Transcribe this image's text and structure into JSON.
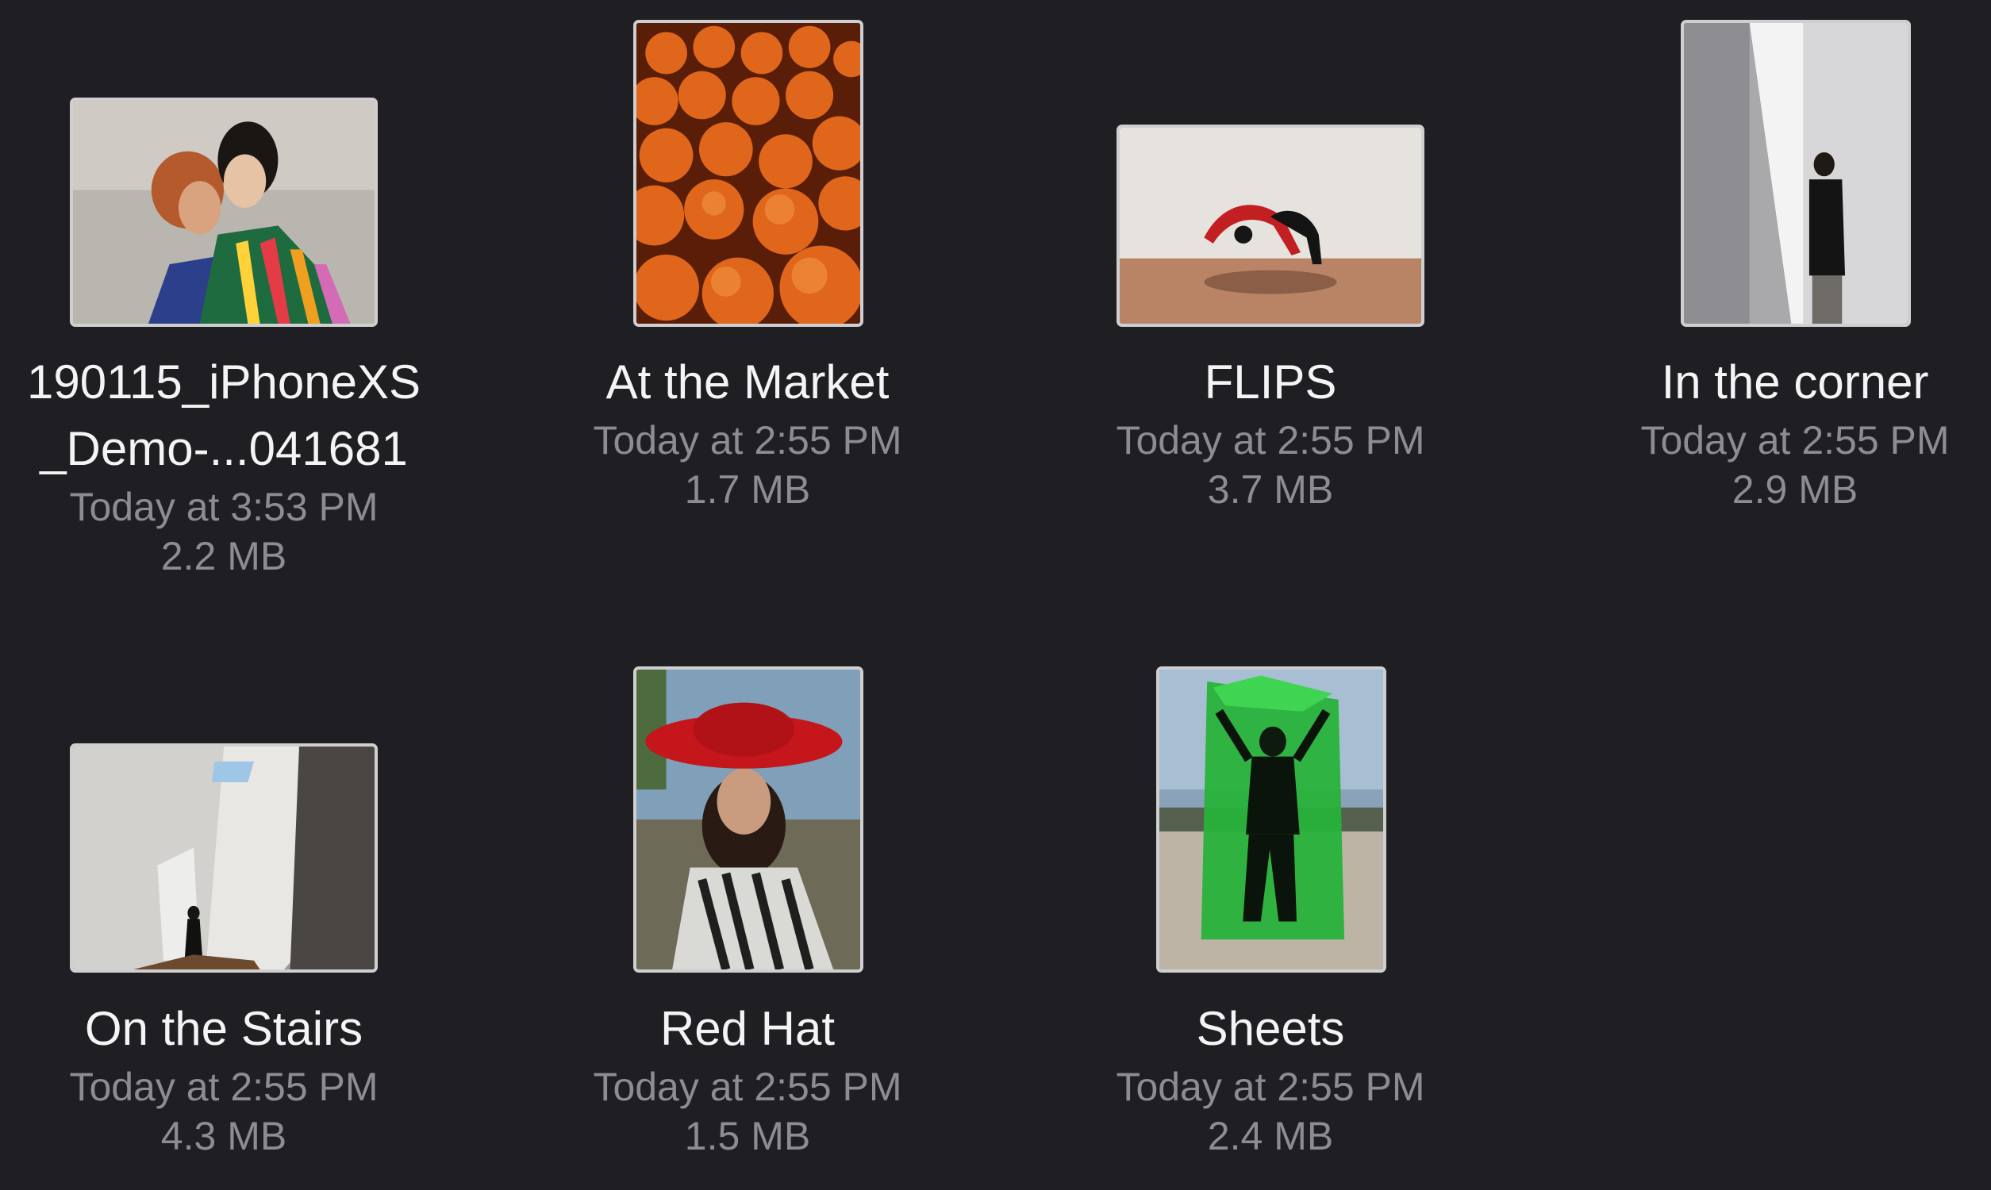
{
  "files": [
    {
      "name_line1": "190115_iPhoneXS",
      "name_line2": "_Demo-...041681",
      "date": "Today at 3:53 PM",
      "size": "2.2 MB"
    },
    {
      "name": "At the Market",
      "date": "Today at 2:55 PM",
      "size": "1.7 MB"
    },
    {
      "name": "FLIPS",
      "date": "Today at 2:55 PM",
      "size": "3.7 MB"
    },
    {
      "name": "In the corner",
      "date": "Today at 2:55 PM",
      "size": "2.9 MB"
    },
    {
      "name": "On the Stairs",
      "date": "Today at 2:55 PM",
      "size": "4.3 MB"
    },
    {
      "name": "Red Hat",
      "date": "Today at 2:55 PM",
      "size": "1.5 MB"
    },
    {
      "name": "Sheets",
      "date": "Today at 2:55 PM",
      "size": "2.4 MB"
    }
  ]
}
